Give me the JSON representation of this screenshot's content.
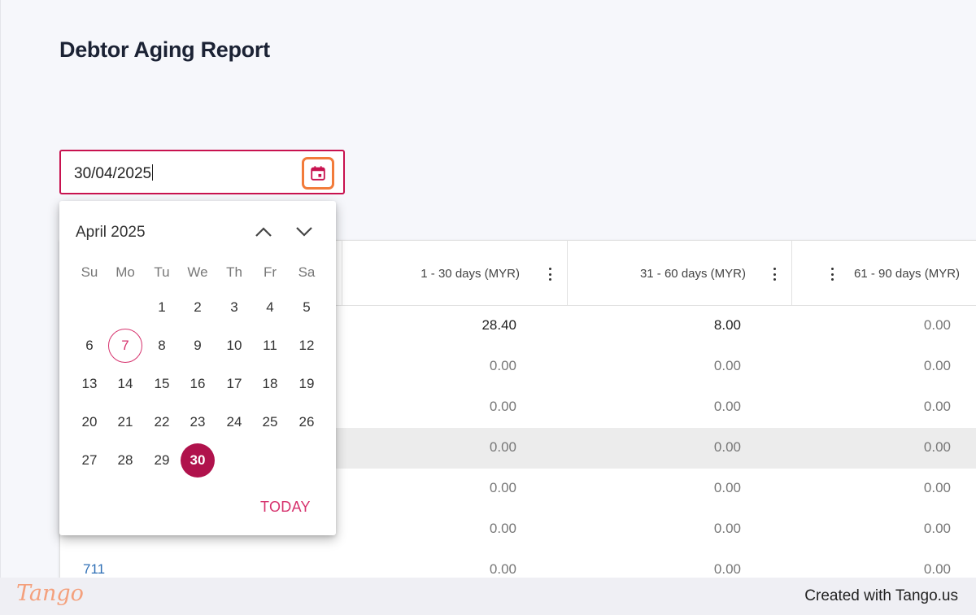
{
  "page": {
    "title": "Debtor Aging Report"
  },
  "date_field": {
    "value": "30/04/2025"
  },
  "table": {
    "headers": [
      "1 - 30 days (MYR)",
      "31 - 60 days (MYR)",
      "61 - 90 days (MYR)"
    ],
    "rows": [
      {
        "first": "",
        "c1": "28.40",
        "c2": "8.00",
        "c3": "0.00"
      },
      {
        "first": "",
        "c1": "0.00",
        "c2": "0.00",
        "c3": "0.00"
      },
      {
        "first": "",
        "c1": "0.00",
        "c2": "0.00",
        "c3": "0.00"
      },
      {
        "first": "",
        "c1": "0.00",
        "c2": "0.00",
        "c3": "0.00"
      },
      {
        "first": "",
        "c1": "0.00",
        "c2": "0.00",
        "c3": "0.00"
      },
      {
        "first": "",
        "c1": "0.00",
        "c2": "0.00",
        "c3": "0.00"
      },
      {
        "first": "711",
        "c1": "0.00",
        "c2": "0.00",
        "c3": "0.00"
      }
    ]
  },
  "calendar": {
    "month_label": "April 2025",
    "weekdays": [
      "Su",
      "Mo",
      "Tu",
      "We",
      "Th",
      "Fr",
      "Sa"
    ],
    "weeks": [
      [
        "",
        "",
        "1",
        "2",
        "3",
        "4",
        "5"
      ],
      [
        "6",
        "7",
        "8",
        "9",
        "10",
        "11",
        "12"
      ],
      [
        "13",
        "14",
        "15",
        "16",
        "17",
        "18",
        "19"
      ],
      [
        "20",
        "21",
        "22",
        "23",
        "24",
        "25",
        "26"
      ],
      [
        "27",
        "28",
        "29",
        "30",
        "",
        "",
        ""
      ]
    ],
    "current_day": "7",
    "selected_day": "30",
    "today_label": "TODAY"
  },
  "footer": {
    "brand": "Tango",
    "created_text": "Created with Tango.us"
  },
  "colors": {
    "accent": "#c8124f",
    "selected": "#b0124c",
    "highlight_box": "#f27b3a"
  },
  "icons": {
    "calendar": "calendar-icon",
    "prev": "chevron-up-icon",
    "next": "chevron-down-icon",
    "column_menu": "kebab-menu-icon"
  }
}
